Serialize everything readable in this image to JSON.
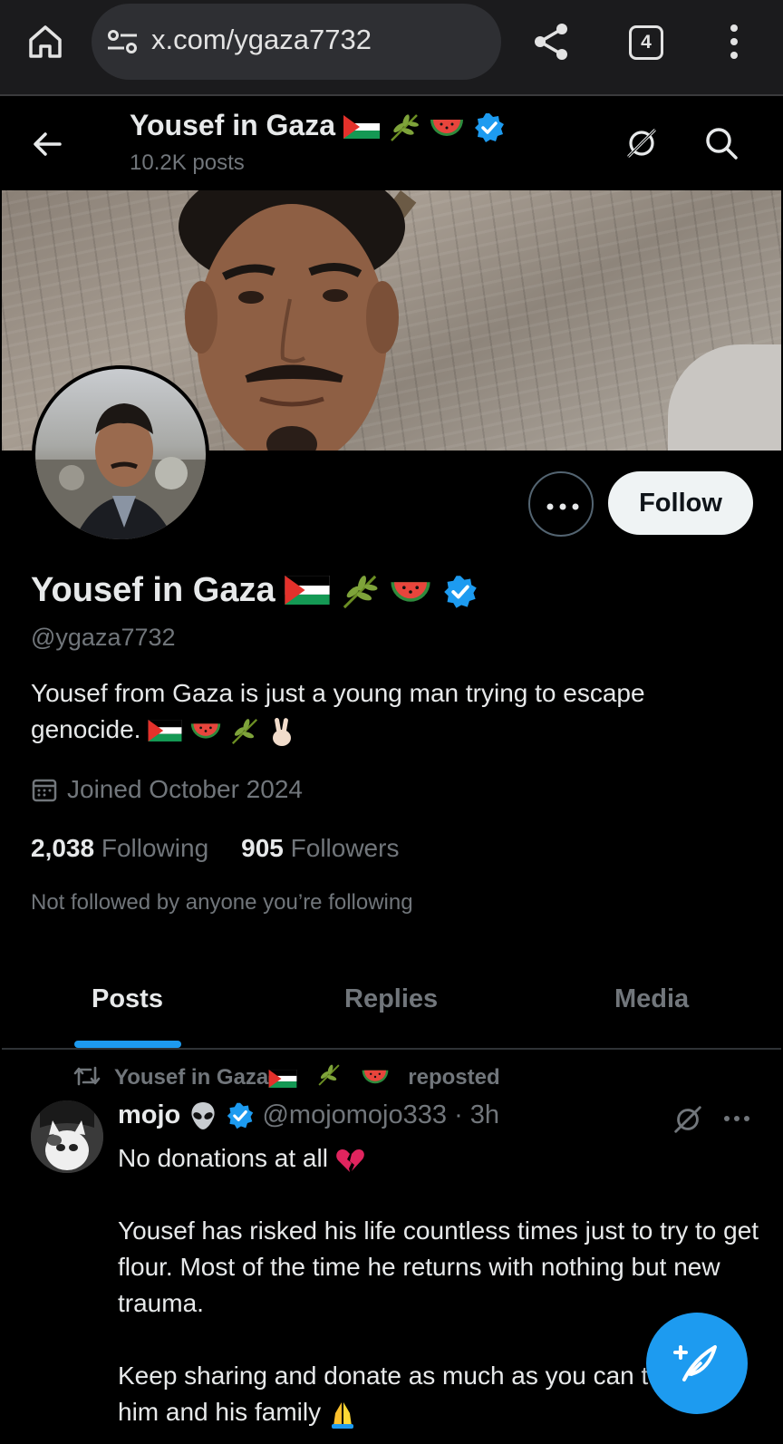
{
  "browser": {
    "url": "x.com/ygaza7732",
    "tab_count": "4"
  },
  "header": {
    "title": "Yousef in Gaza",
    "posts_count": "10.2K posts"
  },
  "profile": {
    "name": "Yousef in Gaza",
    "handle": "@ygaza7732",
    "bio": "Yousef from Gaza is just a young man trying to escape genocide.",
    "joined": "Joined October 2024",
    "following_count": "2,038",
    "following_label": "Following",
    "followers_count": "905",
    "followers_label": "Followers",
    "not_followed_text": "Not followed by anyone you’re following",
    "follow_label": "Follow"
  },
  "tabs": [
    {
      "label": "Posts",
      "active": true
    },
    {
      "label": "Replies",
      "active": false
    },
    {
      "label": "Media",
      "active": false
    }
  ],
  "post": {
    "repost_name": "Yousef in Gaza",
    "repost_label": "reposted",
    "author_name": "mojo",
    "author_handle": "@mojomojo333",
    "time": "3h",
    "paragraphs": [
      "No donations at all",
      "Yousef has risked his life countless times just to try to get flour. Most of the time he returns with nothing but new trauma.",
      "Keep sharing and donate as much as you can to help him and his family"
    ]
  },
  "colors": {
    "accent": "#1d9bf0",
    "background": "#000000",
    "muted": "#71767b"
  },
  "icons": [
    "home-icon",
    "site-settings-icon",
    "share-icon",
    "tab-switcher-icon",
    "overflow-menu-icon",
    "back-arrow-icon",
    "grok-icon",
    "search-icon",
    "verified-badge-icon",
    "calendar-icon",
    "repost-icon",
    "compose-icon"
  ]
}
